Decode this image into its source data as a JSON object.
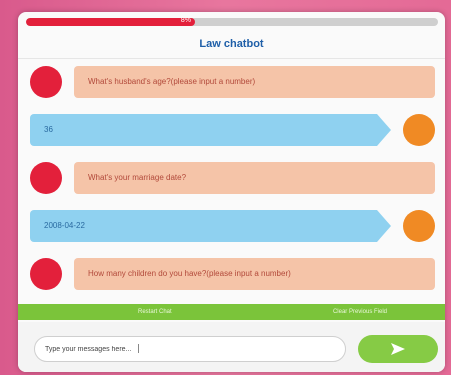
{
  "progress": {
    "label": "8%",
    "fraction": 0.41
  },
  "header": {
    "title": "Law chatbot"
  },
  "messages": [
    {
      "sender": "bot",
      "text": "What's husband's age?(please input a number)"
    },
    {
      "sender": "user",
      "text": "36"
    },
    {
      "sender": "bot",
      "text": "What's your marriage date?"
    },
    {
      "sender": "user",
      "text": "2008-04-22"
    },
    {
      "sender": "bot",
      "text": "How many children do you have?(please input a number)"
    }
  ],
  "footer_bar": {
    "left_text": "Restart Chat",
    "right_text": "Clear Previous Field"
  },
  "composer": {
    "placeholder": "Type your messages here...",
    "send_icon": "send-arrow-icon"
  },
  "colors": {
    "accent_red": "#e3203b",
    "user_orange": "#f08a24",
    "bot_bubble": "#f5c4a8",
    "user_bubble": "#8fd1f0",
    "green": "#7bc43a",
    "title_blue": "#1f5fa8"
  }
}
